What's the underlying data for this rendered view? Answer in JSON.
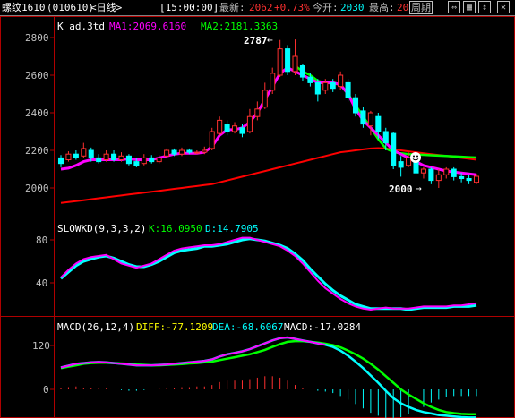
{
  "header": {
    "symbol": "螺纹1610",
    "code": "(010610)",
    "period": "<日线>",
    "time": "[15:00:00]",
    "latest_label": "最新:",
    "latest_value": "2062",
    "change": "+0.73%",
    "open_label": "今开:",
    "open_value": "2030",
    "high_label": "最高:",
    "high_value": "20",
    "cycle_label": "周期",
    "buttons": [
      "⇔",
      "▦",
      "↕",
      "✕"
    ]
  },
  "main_panel": {
    "title": "K  ad.3td",
    "ma1_label": "MA1:2069.6160",
    "ma2_label": "MA2:2181.3363",
    "y_ticks": [
      "2800",
      "2600",
      "2400",
      "2200",
      "2000"
    ],
    "annotation_high": "2787",
    "annotation_low": "2000",
    "face_icon": "smiley-icon"
  },
  "kd_panel": {
    "title": "SLOWKD(9,3,3,2)",
    "k_label": "K:16.0950",
    "d_label": "D:14.7905",
    "y_ticks": [
      "80",
      "40"
    ]
  },
  "macd_panel": {
    "title": "MACD(26,12,4)",
    "diff_label": "DIFF:-77.1209",
    "dea_label": "DEA:-68.6067",
    "macd_label": "MACD:-17.0284",
    "y_ticks": [
      "120",
      "0"
    ]
  },
  "colors": {
    "up": "#ff3030",
    "down": "#00ffff",
    "ma1": "#ff00ff",
    "ma2": "#00ff00",
    "slow_ma": "#ff0000",
    "white": "#ffffff",
    "yellow": "#ffff00",
    "border": "#b00000"
  },
  "chart_data": {
    "type": "candlestick",
    "price_range": [
      1880,
      2840
    ],
    "candles": [
      {
        "o": 2160,
        "c": 2130,
        "h": 2175,
        "l": 2110
      },
      {
        "o": 2150,
        "c": 2180,
        "h": 2195,
        "l": 2140
      },
      {
        "o": 2180,
        "c": 2160,
        "h": 2200,
        "l": 2150
      },
      {
        "o": 2170,
        "c": 2210,
        "h": 2240,
        "l": 2160
      },
      {
        "o": 2200,
        "c": 2160,
        "h": 2215,
        "l": 2140
      },
      {
        "o": 2160,
        "c": 2140,
        "h": 2180,
        "l": 2130
      },
      {
        "o": 2150,
        "c": 2180,
        "h": 2200,
        "l": 2140
      },
      {
        "o": 2180,
        "c": 2150,
        "h": 2200,
        "l": 2140
      },
      {
        "o": 2150,
        "c": 2170,
        "h": 2190,
        "l": 2140
      },
      {
        "o": 2170,
        "c": 2130,
        "h": 2180,
        "l": 2120
      },
      {
        "o": 2140,
        "c": 2120,
        "h": 2160,
        "l": 2110
      },
      {
        "o": 2130,
        "c": 2160,
        "h": 2180,
        "l": 2120
      },
      {
        "o": 2160,
        "c": 2140,
        "h": 2175,
        "l": 2130
      },
      {
        "o": 2140,
        "c": 2160,
        "h": 2175,
        "l": 2130
      },
      {
        "o": 2170,
        "c": 2200,
        "h": 2210,
        "l": 2160
      },
      {
        "o": 2200,
        "c": 2180,
        "h": 2210,
        "l": 2170
      },
      {
        "o": 2180,
        "c": 2200,
        "h": 2215,
        "l": 2170
      },
      {
        "o": 2200,
        "c": 2190,
        "h": 2210,
        "l": 2180
      },
      {
        "o": 2190,
        "c": 2190,
        "h": 2200,
        "l": 2180
      },
      {
        "o": 2190,
        "c": 2200,
        "h": 2220,
        "l": 2180
      },
      {
        "o": 2210,
        "c": 2300,
        "h": 2320,
        "l": 2200
      },
      {
        "o": 2290,
        "c": 2360,
        "h": 2380,
        "l": 2280
      },
      {
        "o": 2340,
        "c": 2300,
        "h": 2360,
        "l": 2280
      },
      {
        "o": 2300,
        "c": 2330,
        "h": 2350,
        "l": 2290
      },
      {
        "o": 2320,
        "c": 2290,
        "h": 2340,
        "l": 2270
      },
      {
        "o": 2300,
        "c": 2380,
        "h": 2420,
        "l": 2290
      },
      {
        "o": 2380,
        "c": 2420,
        "h": 2460,
        "l": 2360
      },
      {
        "o": 2430,
        "c": 2520,
        "h": 2560,
        "l": 2420
      },
      {
        "o": 2520,
        "c": 2610,
        "h": 2640,
        "l": 2500
      },
      {
        "o": 2600,
        "c": 2740,
        "h": 2787,
        "l": 2590
      },
      {
        "o": 2740,
        "c": 2620,
        "h": 2760,
        "l": 2600
      },
      {
        "o": 2620,
        "c": 2700,
        "h": 2790,
        "l": 2600
      },
      {
        "o": 2650,
        "c": 2590,
        "h": 2660,
        "l": 2570
      },
      {
        "o": 2590,
        "c": 2560,
        "h": 2610,
        "l": 2540
      },
      {
        "o": 2560,
        "c": 2500,
        "h": 2580,
        "l": 2460
      },
      {
        "o": 2520,
        "c": 2560,
        "h": 2580,
        "l": 2500
      },
      {
        "o": 2560,
        "c": 2530,
        "h": 2580,
        "l": 2510
      },
      {
        "o": 2540,
        "c": 2600,
        "h": 2620,
        "l": 2520
      },
      {
        "o": 2560,
        "c": 2480,
        "h": 2580,
        "l": 2460
      },
      {
        "o": 2480,
        "c": 2400,
        "h": 2500,
        "l": 2380
      },
      {
        "o": 2410,
        "c": 2340,
        "h": 2430,
        "l": 2320
      },
      {
        "o": 2330,
        "c": 2400,
        "h": 2410,
        "l": 2280
      },
      {
        "o": 2380,
        "c": 2300,
        "h": 2400,
        "l": 2260
      },
      {
        "o": 2300,
        "c": 2240,
        "h": 2320,
        "l": 2200
      },
      {
        "o": 2290,
        "c": 2120,
        "h": 2300,
        "l": 2100
      },
      {
        "o": 2140,
        "c": 2110,
        "h": 2170,
        "l": 2060
      },
      {
        "o": 2120,
        "c": 2160,
        "h": 2190,
        "l": 2110
      },
      {
        "o": 2150,
        "c": 2080,
        "h": 2160,
        "l": 2060
      },
      {
        "o": 2080,
        "c": 2100,
        "h": 2110,
        "l": 2050
      },
      {
        "o": 2100,
        "c": 2040,
        "h": 2110,
        "l": 2020
      },
      {
        "o": 2040,
        "c": 2070,
        "h": 2100,
        "l": 2000
      },
      {
        "o": 2070,
        "c": 2100,
        "h": 2110,
        "l": 2050
      },
      {
        "o": 2100,
        "c": 2060,
        "h": 2110,
        "l": 2040
      },
      {
        "o": 2060,
        "c": 2050,
        "h": 2080,
        "l": 2030
      },
      {
        "o": 2050,
        "c": 2040,
        "h": 2070,
        "l": 2020
      },
      {
        "o": 2030,
        "c": 2062,
        "h": 2075,
        "l": 2020
      }
    ],
    "ma1": [
      2100,
      2105,
      2120,
      2140,
      2150,
      2150,
      2150,
      2150,
      2150,
      2155,
      2150,
      2150,
      2150,
      2160,
      2170,
      2180,
      2185,
      2185,
      2185,
      2190,
      2220,
      2280,
      2310,
      2310,
      2320,
      2350,
      2400,
      2470,
      2540,
      2610,
      2640,
      2620,
      2600,
      2580,
      2560,
      2560,
      2560,
      2550,
      2500,
      2420,
      2360,
      2320,
      2280,
      2240,
      2200,
      2180,
      2160,
      2140,
      2120,
      2110,
      2100,
      2090,
      2085,
      2080,
      2075,
      2070
    ],
    "ma2": [
      null,
      null,
      null,
      null,
      null,
      null,
      null,
      null,
      null,
      null,
      null,
      null,
      null,
      null,
      null,
      null,
      null,
      null,
      null,
      null,
      null,
      null,
      null,
      null,
      null,
      null,
      null,
      null,
      null,
      null,
      null,
      2650,
      2620,
      2600,
      2570,
      2560,
      2555,
      2550,
      2500,
      2440,
      2380,
      2320,
      2260,
      2210,
      2190,
      2185,
      2180,
      2178,
      2176,
      2174,
      2172,
      2170,
      2168,
      2166,
      2164,
      2162
    ],
    "slow_ma": [
      1920,
      1925,
      1930,
      1935,
      1940,
      1945,
      1950,
      1955,
      1960,
      1965,
      1970,
      1975,
      1980,
      1985,
      1990,
      1995,
      2000,
      2005,
      2010,
      2015,
      2020,
      2030,
      2040,
      2050,
      2060,
      2070,
      2080,
      2090,
      2100,
      2110,
      2120,
      2130,
      2140,
      2150,
      2160,
      2170,
      2180,
      2190,
      2195,
      2200,
      2205,
      2210,
      2212,
      2210,
      2205,
      2200,
      2195,
      2190,
      2185,
      2180,
      2175,
      2170,
      2165,
      2160,
      2155,
      2150
    ],
    "kd_k": [
      45,
      52,
      58,
      62,
      64,
      65,
      66,
      62,
      58,
      56,
      54,
      56,
      58,
      62,
      66,
      70,
      72,
      73,
      74,
      75,
      75,
      76,
      78,
      80,
      82,
      82,
      80,
      78,
      76,
      74,
      70,
      65,
      58,
      50,
      42,
      35,
      30,
      25,
      21,
      18,
      16,
      15,
      16,
      17,
      16,
      16,
      16,
      17,
      18,
      18,
      18,
      18,
      19,
      19,
      20,
      21
    ],
    "kd_d": [
      44,
      50,
      56,
      60,
      62,
      64,
      65,
      63,
      60,
      57,
      55,
      55,
      57,
      60,
      64,
      68,
      70,
      71,
      72,
      74,
      74,
      75,
      76,
      78,
      80,
      81,
      80,
      79,
      77,
      75,
      72,
      67,
      61,
      53,
      46,
      39,
      33,
      28,
      24,
      20,
      18,
      16,
      16,
      16,
      16,
      16,
      15,
      16,
      17,
      17,
      17,
      17,
      18,
      18,
      18,
      19
    ],
    "macd_diff": [
      60,
      65,
      70,
      72,
      74,
      75,
      74,
      72,
      70,
      68,
      66,
      66,
      66,
      67,
      68,
      70,
      72,
      74,
      76,
      78,
      82,
      90,
      96,
      100,
      104,
      110,
      118,
      126,
      134,
      140,
      142,
      138,
      134,
      130,
      126,
      122,
      116,
      106,
      92,
      76,
      58,
      38,
      18,
      -4,
      -24,
      -38,
      -48,
      -56,
      -62,
      -66,
      -70,
      -72,
      -74,
      -76,
      -77,
      -77
    ],
    "macd_dea": [
      58,
      62,
      66,
      70,
      72,
      73,
      73,
      72,
      71,
      70,
      68,
      67,
      66,
      66,
      67,
      68,
      69,
      71,
      72,
      74,
      76,
      80,
      84,
      88,
      92,
      96,
      102,
      108,
      116,
      124,
      130,
      132,
      132,
      130,
      128,
      125,
      121,
      115,
      106,
      96,
      84,
      70,
      54,
      36,
      18,
      0,
      -14,
      -26,
      -38,
      -48,
      -56,
      -62,
      -65,
      -67,
      -68,
      -68
    ]
  }
}
